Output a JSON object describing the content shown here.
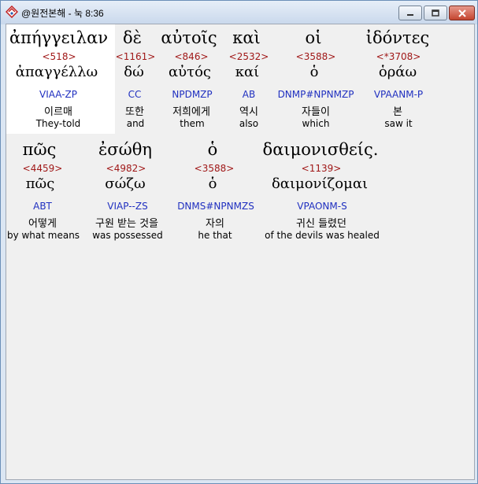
{
  "window": {
    "title": "@원전본해 - 눅 8:36"
  },
  "rows": [
    {
      "words": [
        {
          "greek": "ἀπήγγειλαν",
          "strong": "<518>",
          "lemma": "ἀπαγγέλλω",
          "morph": "VIAA-ZP",
          "korean": "이르매",
          "english": "They-told"
        },
        {
          "greek": "δὲ",
          "strong": "<1161>",
          "lemma": "δώ",
          "morph": "CC",
          "korean": "또한",
          "english": "and"
        },
        {
          "greek": "αὐτοῖς",
          "strong": "<846>",
          "lemma": "αὐτός",
          "morph": "NPDMZP",
          "korean": "저희에게",
          "english": "them"
        },
        {
          "greek": "καὶ",
          "strong": "<2532>",
          "lemma": "καί",
          "morph": "AB",
          "korean": "역시",
          "english": "also"
        },
        {
          "greek": "οἱ",
          "strong": "<3588>",
          "lemma": "ὁ",
          "morph": "DNMP#NPNMZP",
          "korean": "자들이",
          "english": "which"
        },
        {
          "greek": "ἰδόντες",
          "strong": "<*3708>",
          "lemma": "ὁράω",
          "morph": "VPAANM-P",
          "korean": "본",
          "english": "saw it"
        }
      ]
    },
    {
      "words": [
        {
          "greek": "πῶς",
          "strong": "<4459>",
          "lemma": "πῶς",
          "morph": "ABT",
          "korean": "어떻게",
          "english": "by what means"
        },
        {
          "greek": "ἐσώθη",
          "strong": "<4982>",
          "lemma": "σώζω",
          "morph": "VIAP--ZS",
          "korean": "구원 받는 것을",
          "english": "was possessed"
        },
        {
          "greek": "ὁ",
          "strong": "<3588>",
          "lemma": "ὁ",
          "morph": "DNMS#NPNMZS",
          "korean": "자의",
          "english": "he that"
        },
        {
          "greek": "δαιμονισθείς.",
          "strong": "<1139>",
          "lemma": "δαιμονίζομαι",
          "morph": "VPAONM-S",
          "korean": "귀신 들렸던",
          "english": "of the devils was healed"
        }
      ]
    }
  ]
}
